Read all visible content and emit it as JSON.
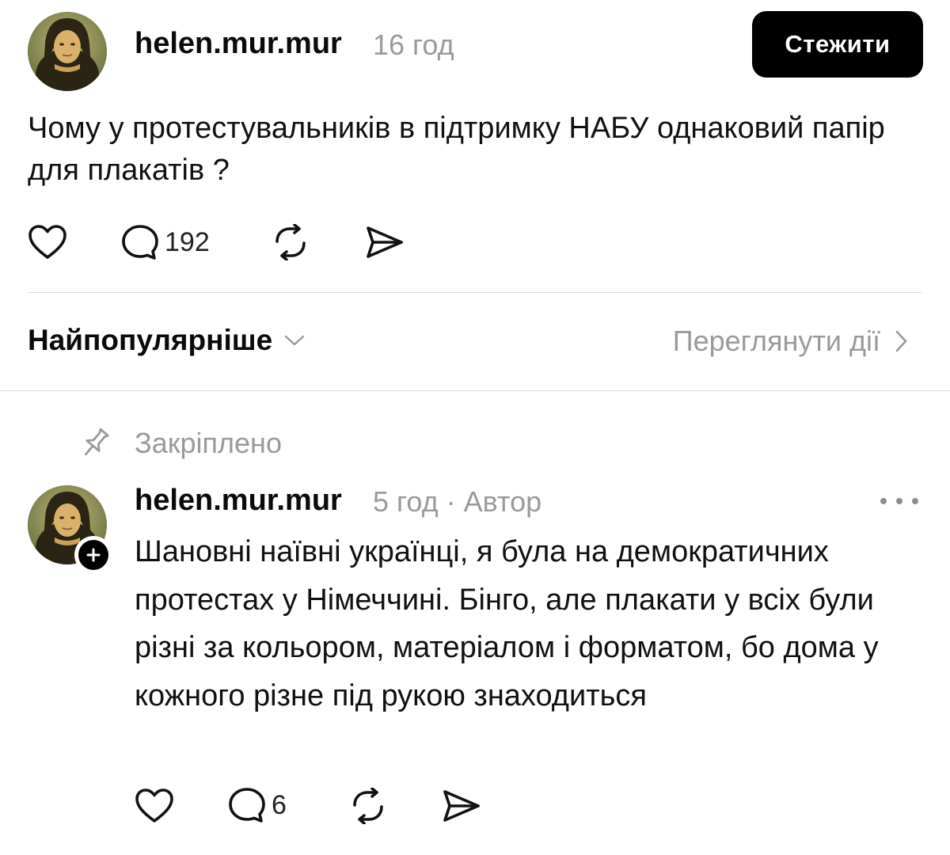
{
  "post": {
    "username": "helen.mur.mur",
    "time": "16 год",
    "follow_label": "Стежити",
    "text": "Чому у протестувальників в підтримку НАБУ однаковий папір для плакатів ?",
    "reply_count": "192",
    "icons": [
      "heart-icon",
      "comment-icon",
      "repost-icon",
      "share-icon"
    ]
  },
  "sort": {
    "label": "Найпопулярніше",
    "view_activity_label": "Переглянути дії"
  },
  "reply": {
    "pinned_label": "Закріплено",
    "username": "helen.mur.mur",
    "time": "5 год",
    "separator": "·",
    "author_label": "Автор",
    "text": "Шановні наївні українці, я була на демократичних протестах у Німеччині. Бінго, але плакати у всіх були різні за кольором, матеріалом і форматом, бо дома у кожного різне під рукою знаходиться",
    "reply_count": "6"
  },
  "colors": {
    "text": "#0a0a0a",
    "muted": "#9a9a9a",
    "button_bg": "#000000",
    "button_text": "#ffffff",
    "divider": "#dcdcdc"
  }
}
